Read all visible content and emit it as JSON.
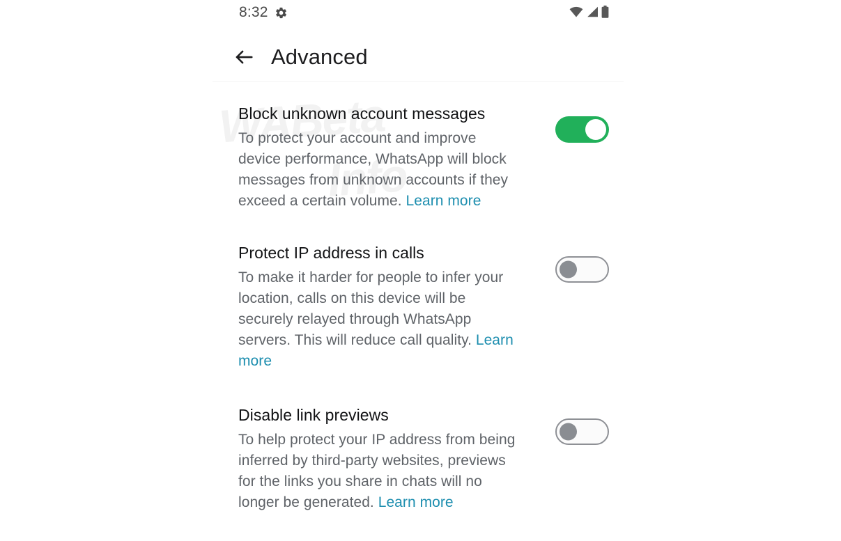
{
  "status_bar": {
    "time": "8:32",
    "icons": [
      "gear-icon",
      "wifi-icon",
      "cellular-signal-icon",
      "battery-icon"
    ]
  },
  "app_bar": {
    "back_icon": "arrow-left-icon",
    "title": "Advanced"
  },
  "colors": {
    "toggle_on": "#21b05a",
    "toggle_off_knob": "#8a8d92",
    "link": "#1d8eaf",
    "title_text": "#111214",
    "body_text": "#5f6368",
    "background": "#ffffff"
  },
  "watermark": {
    "line1": "WABeta",
    "line2": "Info"
  },
  "settings": [
    {
      "title": "Block unknown account messages",
      "description": "To protect your account and improve device performance, WhatsApp will block messages from unknown accounts if they exceed a certain volume. ",
      "link_label": "Learn more",
      "link_inline": true,
      "toggle_state": "on",
      "toggle_state_label": "On"
    },
    {
      "title": "Protect IP address in calls",
      "description": "To make it harder for people to infer your location, calls on this device will be securely relayed through WhatsApp servers. This will reduce call quality. ",
      "link_label": "Learn more",
      "link_inline": true,
      "toggle_state": "off",
      "toggle_state_label": "Off"
    },
    {
      "title": "Disable link previews",
      "description": "To help protect your IP address from being inferred by third-party websites, previews for the links you share in chats will no longer be generated. ",
      "link_label": "Learn more",
      "link_inline": true,
      "toggle_state": "off",
      "toggle_state_label": "Off"
    }
  ]
}
